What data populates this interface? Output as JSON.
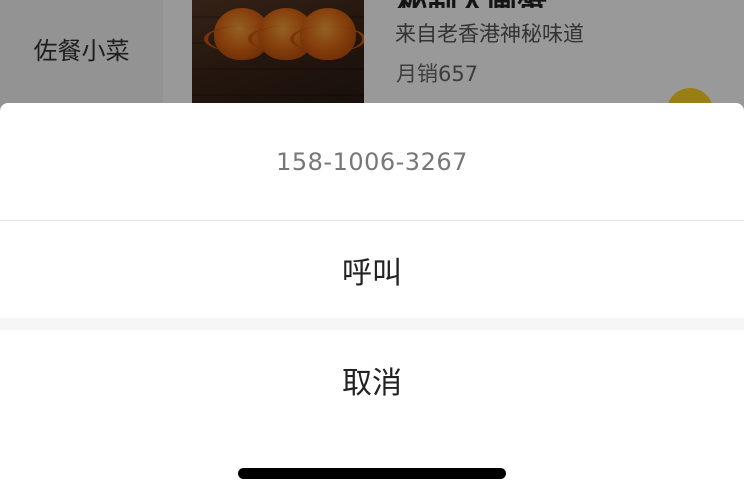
{
  "background": {
    "category": "佐餐小菜",
    "food_name_partial": "秘制大闸蟹",
    "food_desc": "来自老香港神秘味道",
    "food_sales": "月销657",
    "colors": {
      "accent": "#ffd21f",
      "overlay": "rgba(0,0,0,0.4)"
    }
  },
  "action_sheet": {
    "phone_number": "158-1006-3267",
    "call_label": "呼叫",
    "cancel_label": "取消"
  }
}
